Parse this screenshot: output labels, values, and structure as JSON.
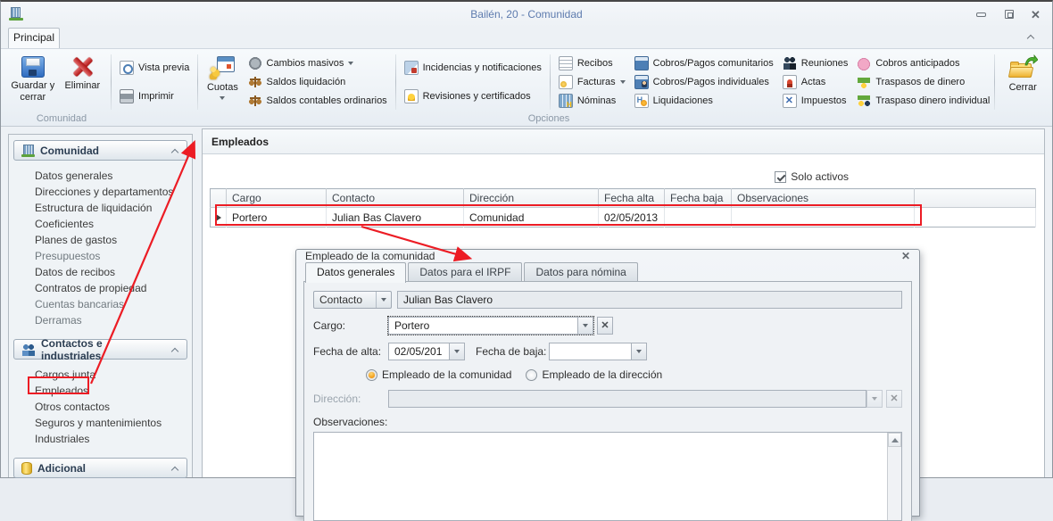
{
  "window": {
    "title": "Bailén, 20 - Comunidad",
    "tab": "Principal"
  },
  "ribbon": {
    "group_labels": {
      "comunidad": "Comunidad",
      "opciones": "Opciones"
    },
    "buttons": {
      "guardar": "Guardar y cerrar",
      "eliminar": "Eliminar",
      "vista_previa": "Vista previa",
      "imprimir": "Imprimir",
      "cuotas": "Cuotas",
      "cambios_masivos": "Cambios masivos",
      "saldos_liquidacion": "Saldos liquidación",
      "saldos_contables": "Saldos contables ordinarios",
      "incidencias": "Incidencias y notificaciones",
      "revisiones": "Revisiones y certificados",
      "recibos": "Recibos",
      "facturas": "Facturas",
      "nominas": "Nóminas",
      "cobros_comunitarios": "Cobros/Pagos comunitarios",
      "cobros_individuales": "Cobros/Pagos individuales",
      "liquidaciones": "Liquidaciones",
      "reuniones": "Reuniones",
      "actas": "Actas",
      "impuestos": "Impuestos",
      "cobros_anticipados": "Cobros anticipados",
      "traspasos_dinero": "Traspasos de dinero",
      "traspaso_individual": "Traspaso dinero individual",
      "cerrar": "Cerrar"
    }
  },
  "sidebar": {
    "groups": [
      {
        "label": "Comunidad",
        "items": [
          "Datos generales",
          "Direcciones y departamentos",
          "Estructura de liquidación",
          "Coeficientes",
          "Planes de gastos",
          "Presupuestos",
          "Datos de recibos",
          "Contratos de propiedad",
          "Cuentas bancarias",
          "Derramas"
        ]
      },
      {
        "label": "Contactos e industriales",
        "items": [
          "Cargos junta",
          "Empleados",
          "Otros contactos",
          "Seguros y mantenimientos",
          "Industriales"
        ]
      },
      {
        "label": "Adicional",
        "items": []
      }
    ]
  },
  "main": {
    "title": "Empleados",
    "filter_checkbox": "Solo activos",
    "table": {
      "columns": [
        "Cargo",
        "Contacto",
        "Dirección",
        "Fecha alta",
        "Fecha baja",
        "Observaciones"
      ],
      "rows": [
        [
          "Portero",
          "Julian Bas Clavero",
          "Comunidad",
          "02/05/2013",
          "",
          ""
        ]
      ]
    }
  },
  "dialog": {
    "title": "Empleado de la comunidad",
    "tabs": [
      "Datos generales",
      "Datos para el IRPF",
      "Datos para nómina"
    ],
    "fields": {
      "contacto_selector": "Contacto",
      "contacto_value": "Julian Bas Clavero",
      "cargo_label": "Cargo:",
      "cargo_value": "Portero",
      "fecha_alta_label": "Fecha de alta:",
      "fecha_alta_value": "02/05/201",
      "fecha_baja_label": "Fecha de baja:",
      "fecha_baja_value": "",
      "radio_comunidad": "Empleado de la comunidad",
      "radio_direccion": "Empleado de la dirección",
      "direccion_label": "Dirección:",
      "direccion_value": "",
      "observaciones_label": "Observaciones:"
    }
  },
  "icons": {
    "app": "building-icon",
    "guardar": "floppy-disk-icon",
    "eliminar": "red-x-icon",
    "cuotas": "coins-calendar-icon",
    "cerrar": "open-folder-arrow-icon",
    "sidebar_comunidad": "building-icon",
    "sidebar_contactos": "people-icon",
    "sidebar_adicional": "database-icon"
  },
  "colors": {
    "annotation": "#ec1c24",
    "title_text": "#5d7bae",
    "radio_accent": "#f29b17"
  }
}
